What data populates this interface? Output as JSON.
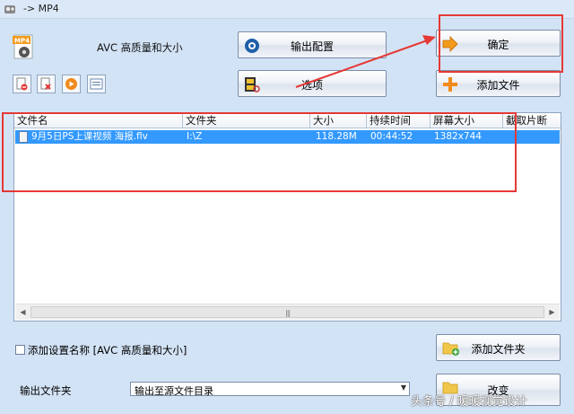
{
  "window": {
    "title": "-> MP4"
  },
  "profile": {
    "label": "AVC 高质量和大小"
  },
  "toolbar": {
    "output_config_label": "输出配置",
    "confirm_label": "确定",
    "options_label": "选项",
    "add_file_label": "添加文件",
    "add_folder_label": "添加文件夹",
    "change_label": "改变"
  },
  "file_list": {
    "columns": [
      "文件名",
      "文件夹",
      "大小",
      "持续时间",
      "屏幕大小",
      "截取片断"
    ],
    "rows": [
      {
        "name": "9月5日PS上课视频 海报.flv",
        "folder": "I:\\Z",
        "size": "118.28M",
        "duration": "00:44:52",
        "resolution": "1382x744",
        "clip": ""
      }
    ]
  },
  "settings": {
    "add_name_label": "添加设置名称 [AVC 高质量和大小]",
    "add_name_checked": false,
    "output_folder_label": "输出文件夹",
    "output_folder_value": "输出至源文件目录"
  },
  "watermark": "头条号 / 暖暖视觉设计",
  "colors": {
    "selection": "#3399ff",
    "annotation": "#e53935",
    "background": "#d3e3f6"
  }
}
